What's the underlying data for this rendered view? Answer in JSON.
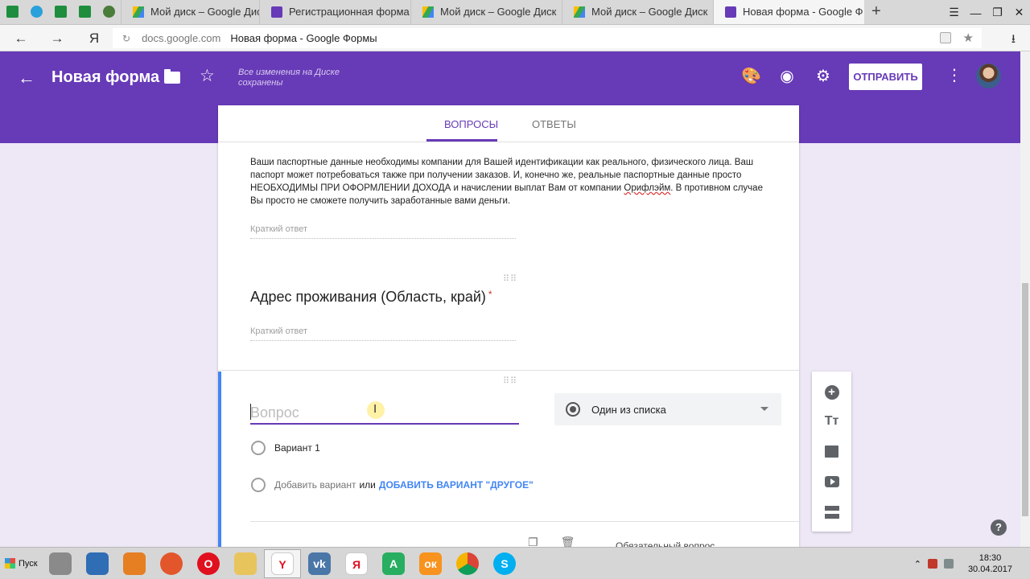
{
  "browser": {
    "tabs": [
      {
        "title": "Мой диск – Google Диск",
        "icon": "google-drive-icon"
      },
      {
        "title": "Регистрационная форма",
        "icon": "google-forms-icon"
      },
      {
        "title": "Мой диск – Google Диск",
        "icon": "google-drive-icon"
      },
      {
        "title": "Мой диск – Google Диск",
        "icon": "google-drive-icon"
      },
      {
        "title": "Новая форма - Google Ф",
        "icon": "google-forms-icon",
        "active": true
      }
    ],
    "new_tab": "+",
    "close_tab": "×",
    "address": {
      "domain": "docs.google.com",
      "page_title": "Новая форма - Google Формы",
      "yandex_mark": "Я"
    }
  },
  "header": {
    "title": "Новая форма",
    "saved_status": "Все изменения на Диске сохранены",
    "send_label": "ОТПРАВИТЬ"
  },
  "form": {
    "tabs": [
      {
        "label": "ВОПРОСЫ",
        "active": true
      },
      {
        "label": "ОТВЕТЫ",
        "active": false
      }
    ],
    "description_a": "Ваши паспортные данные необходимы компании для Вашей идентификации как реального, физического лица. Ваш паспорт может потребоваться также при получении заказов. И, конечно же, реальные паспортные данные просто НЕОБХОДИМЫ ПРИ ОФОРМЛЕНИИ ДОХОДА и начислении выплат Вам от компании ",
    "description_link": "Орифлэйм",
    "description_b": ". В противном случае Вы просто не сможете получить заработанные вами деньги.",
    "short_answer": "Краткий ответ",
    "q2_title": "Адрес проживания (Область, край)",
    "q2_required_mark": "*",
    "active_question": {
      "placeholder": "Вопрос",
      "type_label": "Один из списка",
      "option1": "Вариант 1",
      "add_option": "Добавить вариант",
      "or": "или",
      "add_other": "ДОБАВИТЬ ВАРИАНТ \"ДРУГОЕ\"",
      "required_label": "Обязательный вопрос"
    }
  },
  "taskbar": {
    "start_label": "Пуск",
    "clock_time": "18:30",
    "clock_date": "30.04.2017"
  },
  "colors": {
    "accent": "#673ab7",
    "link": "#4285f4",
    "required": "#d93025"
  }
}
